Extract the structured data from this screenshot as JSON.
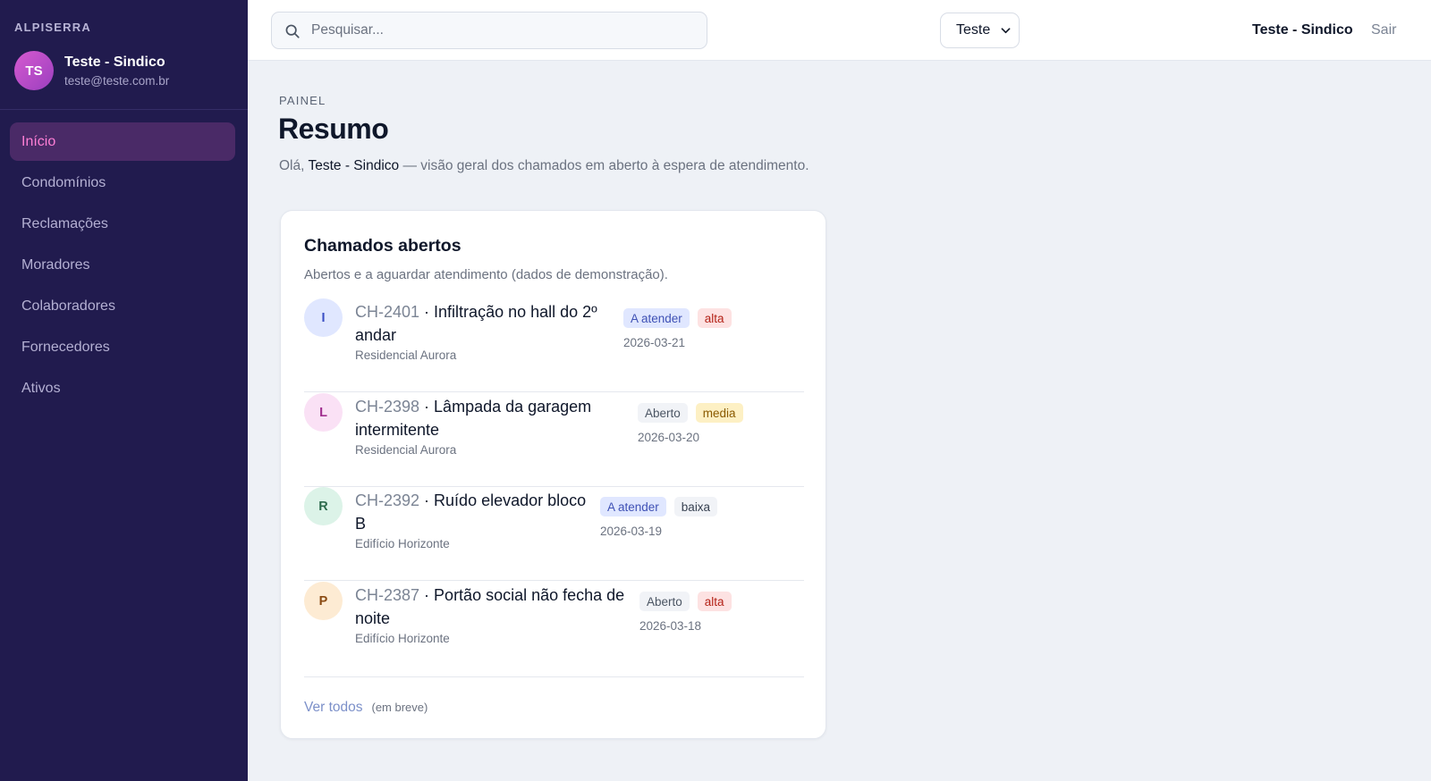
{
  "sidebar": {
    "brand": "ALPISERRA",
    "user": {
      "initials": "TS",
      "name": "Teste - Sindico",
      "email": "teste@teste.com.br"
    },
    "items": [
      {
        "label": "Início",
        "active": true
      },
      {
        "label": "Condomínios"
      },
      {
        "label": "Reclamações"
      },
      {
        "label": "Moradores"
      },
      {
        "label": "Colaboradores"
      },
      {
        "label": "Fornecedores"
      },
      {
        "label": "Ativos"
      }
    ]
  },
  "topbar": {
    "search_placeholder": "Pesquisar...",
    "search_icon": "search-icon",
    "select_value": "Teste",
    "user_name": "Teste - Sindico",
    "logout_label": "Sair"
  },
  "page": {
    "eyebrow": "PAINEL",
    "title": "Resumo",
    "greeting": "Olá,",
    "greeting_name": "Teste - Sindico",
    "greeting_rest": "— visão geral dos chamados em aberto à espera de atendimento."
  },
  "card": {
    "title": "Chamados abertos",
    "subtitle": "Abertos e a aguardar atendimento (dados de demonstração).",
    "tickets": [
      {
        "initial": "I",
        "id": "CH-2401",
        "title_line1": "Infiltração no hall do 2º",
        "title_line2": "andar",
        "place": "Residencial Aurora",
        "status": "A atender",
        "priority": "alta",
        "date": "2026-03-21",
        "avatar_bg": "#e0e7ff",
        "avatar_fg": "#3b4fc4",
        "status_bg": "#e0e7ff",
        "status_fg": "#3f51b5",
        "priority_bg": "#fde2e2",
        "priority_fg": "#b42318"
      },
      {
        "initial": "L",
        "id": "CH-2398",
        "title_line1": "Lâmpada da garagem",
        "title_line2": "intermitente",
        "place": "Residencial Aurora",
        "status": "Aberto",
        "priority": "media",
        "date": "2026-03-20",
        "avatar_bg": "#fae1f5",
        "avatar_fg": "#a12f8f",
        "status_bg": "#f1f3f7",
        "status_fg": "#4b5563",
        "priority_bg": "#fdf0c4",
        "priority_fg": "#8a5a00"
      },
      {
        "initial": "R",
        "id": "CH-2392",
        "title_line1": "Ruído elevador bloco",
        "title_line2": "B",
        "place": "Edifício Horizonte",
        "status": "A atender",
        "priority": "baixa",
        "date": "2026-03-19",
        "avatar_bg": "#dcf3e8",
        "avatar_fg": "#2e6b4d",
        "status_bg": "#e0e7ff",
        "status_fg": "#3f51b5",
        "priority_bg": "#f1f3f7",
        "priority_fg": "#374151"
      },
      {
        "initial": "P",
        "id": "CH-2387",
        "title_line1": "Portão social não fecha de",
        "title_line2": "noite",
        "place": "Edifício Horizonte",
        "status": "Aberto",
        "priority": "alta",
        "date": "2026-03-18",
        "avatar_bg": "#fdebd3",
        "avatar_fg": "#8a4a12",
        "status_bg": "#f1f3f7",
        "status_fg": "#4b5563",
        "priority_bg": "#fde2e2",
        "priority_fg": "#b42318"
      }
    ],
    "see_all": "Ver todos",
    "soon": "(em breve)"
  }
}
